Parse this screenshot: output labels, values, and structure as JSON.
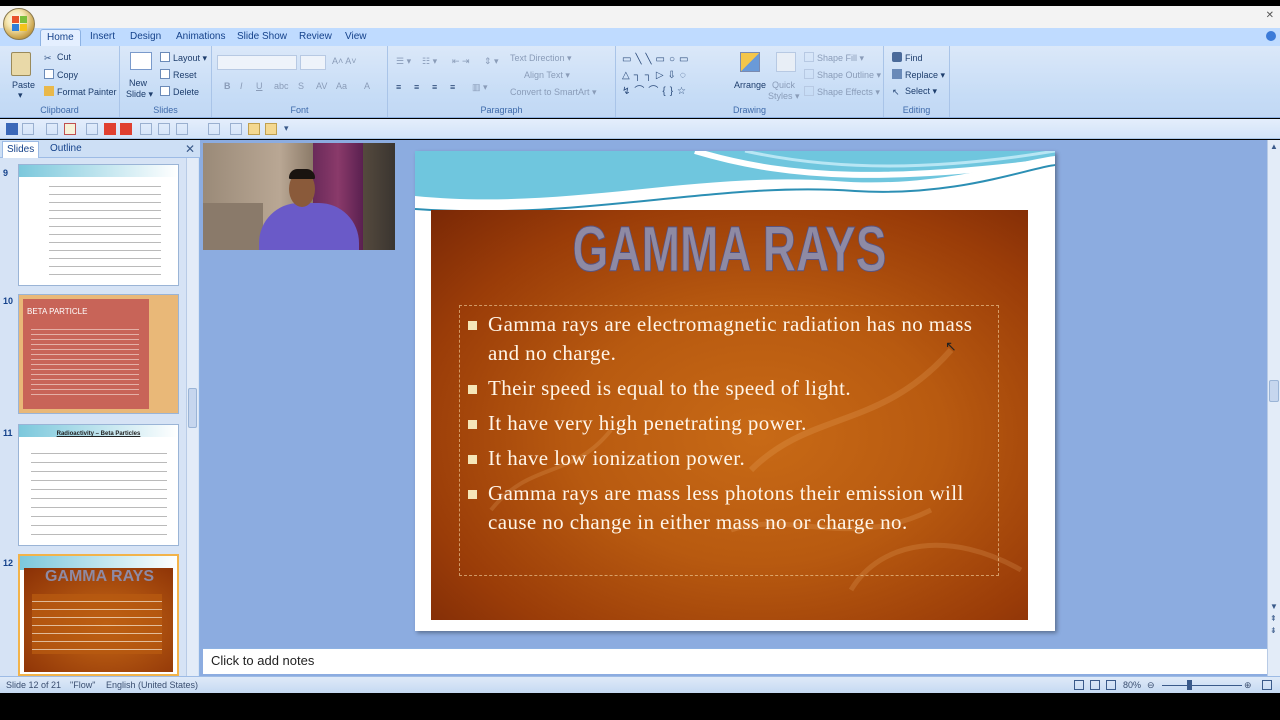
{
  "ribbon": {
    "tabs": [
      "Home",
      "Insert",
      "Design",
      "Animations",
      "Slide Show",
      "Review",
      "View"
    ],
    "clipboard": {
      "paste": "Paste",
      "cut": "Cut",
      "copy": "Copy",
      "format_painter": "Format Painter",
      "label": "Clipboard"
    },
    "slides": {
      "new_slide_1": "New",
      "new_slide_2": "Slide ▾",
      "layout": "Layout ▾",
      "reset": "Reset",
      "delete": "Delete",
      "label": "Slides"
    },
    "font": {
      "label": "Font"
    },
    "paragraph": {
      "text_direction": "Text Direction ▾",
      "align_text": "Align Text ▾",
      "convert_smartart": "Convert to SmartArt ▾",
      "label": "Paragraph"
    },
    "drawing": {
      "arrange": "Arrange",
      "quick_styles_1": "Quick",
      "quick_styles_2": "Styles ▾",
      "shape_fill": "Shape Fill ▾",
      "shape_outline": "Shape Outline ▾",
      "shape_effects": "Shape Effects ▾",
      "label": "Drawing"
    },
    "editing": {
      "find": "Find",
      "replace": "Replace ▾",
      "select": "Select ▾",
      "label": "Editing"
    }
  },
  "panel": {
    "tabs": [
      "Slides",
      "Outline"
    ],
    "thumbs": [
      {
        "num": "9",
        "title": ""
      },
      {
        "num": "10",
        "title": "BETA PARTICLE"
      },
      {
        "num": "11",
        "title": "Radioactivity – Beta Particles"
      },
      {
        "num": "12",
        "title": "GAMMA RAYS"
      }
    ]
  },
  "slide": {
    "title": "GAMMA RAYS",
    "bullets": [
      "Gamma rays are electromagnetic radiation has no mass and no charge.",
      "Their speed is equal to the speed of light.",
      "It have very high penetrating power.",
      "It have low ionization power.",
      "Gamma rays are mass less photons their emission will cause no change in either mass no or charge no."
    ]
  },
  "notes": {
    "placeholder": "Click to add notes"
  },
  "status": {
    "slide_info": "Slide 12 of 21",
    "theme": "\"Flow\"",
    "language": "English (United States)",
    "zoom": "80%"
  },
  "colors": {
    "ribbon": "#c6dcf6",
    "workspace": "#8cace0",
    "slide_bg": "#b85a10",
    "title": "#8e8aa4"
  }
}
